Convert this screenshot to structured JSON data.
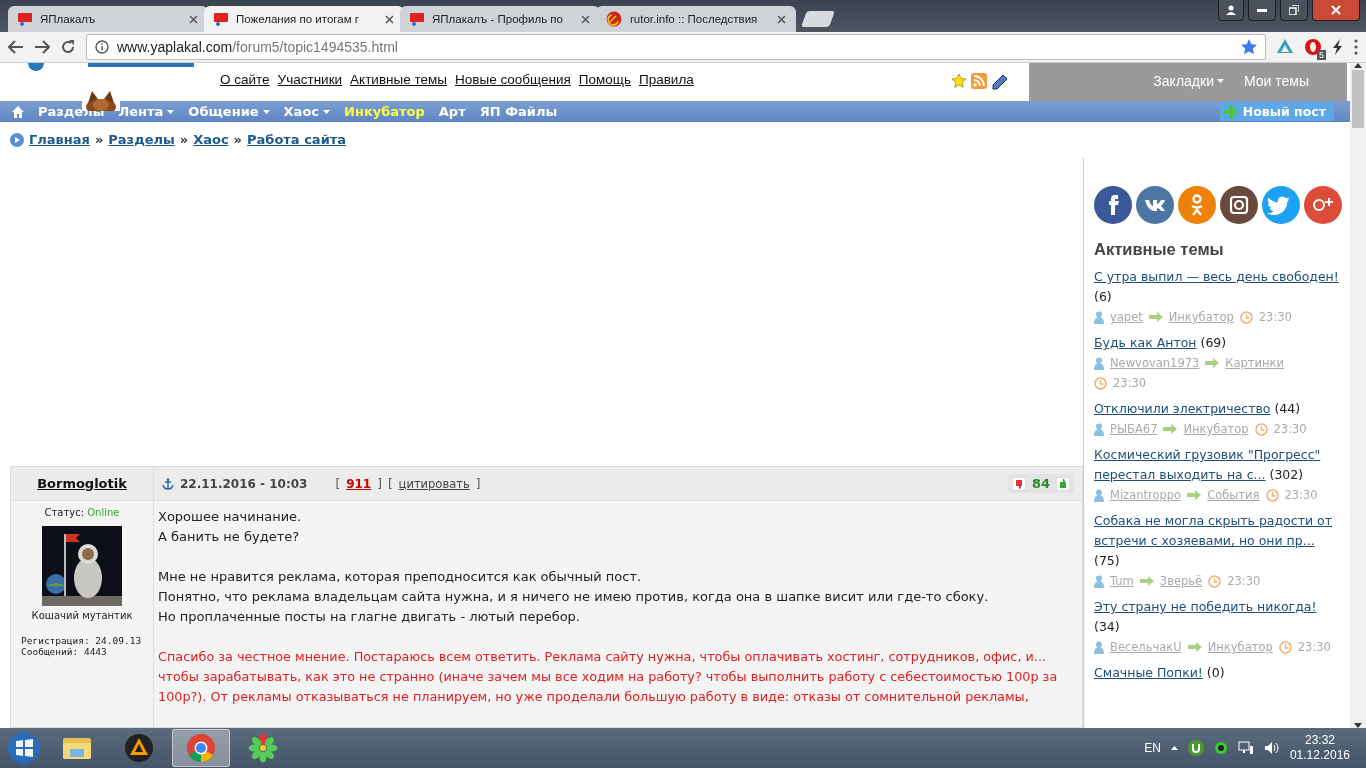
{
  "browser": {
    "tabs": [
      {
        "title": "ЯПлакалъ",
        "selected": false,
        "kind": "yap"
      },
      {
        "title": "Пожелания по итогам г",
        "selected": true,
        "kind": "yap"
      },
      {
        "title": "ЯПлакалъ - Профиль по",
        "selected": false,
        "kind": "yap"
      },
      {
        "title": "rutor.info :: Последствия",
        "selected": false,
        "kind": "rutor"
      }
    ],
    "url_host": "www.yaplakal.com",
    "url_path": "/forum5/topic1494535.html",
    "extension_badge": "5"
  },
  "header": {
    "links": [
      "О сайте",
      "Участники",
      "Активные темы",
      "Новые сообщения",
      "Помощь",
      "Правила"
    ],
    "user_menu": [
      {
        "label": "Закладки",
        "dropdown": true
      },
      {
        "label": "Мои темы",
        "dropdown": false
      }
    ]
  },
  "nav": {
    "items": [
      {
        "label": "Разделы",
        "dropdown": false,
        "highlighted": false
      },
      {
        "label": "Лента",
        "dropdown": true,
        "highlighted": false
      },
      {
        "label": "Общение",
        "dropdown": true,
        "highlighted": false
      },
      {
        "label": "Хаос",
        "dropdown": true,
        "highlighted": false
      },
      {
        "label": "Инкубатор",
        "dropdown": false,
        "highlighted": true
      },
      {
        "label": "Арт",
        "dropdown": false,
        "highlighted": false
      },
      {
        "label": "ЯП Файлы",
        "dropdown": false,
        "highlighted": false
      }
    ],
    "new_post": "Новый пост"
  },
  "breadcrumb": [
    {
      "kind": "link",
      "text": "Главная"
    },
    {
      "kind": "separator",
      "text": "»"
    },
    {
      "kind": "link",
      "text": "Разделы"
    },
    {
      "kind": "separator",
      "text": "»"
    },
    {
      "kind": "link",
      "text": "Хаос"
    },
    {
      "kind": "separator",
      "text": "»"
    },
    {
      "kind": "link",
      "text": "Работа сайта"
    }
  ],
  "post": {
    "author": "Bormoglotik",
    "status_label": "Статус:",
    "status": "Online",
    "rank": "Кошачий мутантик",
    "registration": "Регистрация: 24.09.13",
    "messages": "Сообщений: 4443",
    "date": "22.11.2016 - 10:03",
    "links": [
      {
        "kind": "bracket",
        "text": "["
      },
      {
        "kind": "number",
        "text": "911"
      },
      {
        "kind": "bracket",
        "text": "]"
      },
      {
        "kind": "bracket",
        "text": "["
      },
      {
        "kind": "quote",
        "text": "цитировать"
      },
      {
        "kind": "bracket",
        "text": "]"
      }
    ],
    "rating": "84",
    "paragraphs": [
      {
        "kind": "text",
        "lines": [
          "Хорошее начинание.",
          "А банить не будете?"
        ]
      },
      {
        "kind": "text",
        "lines": [
          "Мне не нравится реклама, которая преподносится как обычный пост.",
          "Понятно, что реклама владельцам сайта нужна, и я ничего не имею против, когда она в шапке висит или где-то сбоку.",
          "Но проплаченные посты на глагне двигать - лютый перебор."
        ]
      },
      {
        "kind": "reply",
        "lines": [
          "Спасибо за честное мнение. Постараюсь всем ответить. Реклама сайту нужна, чтобы оплачивать хостинг, сотрудников, офис, и...",
          "чтобы зарабатывать, как это не странно (иначе зачем мы все ходим на работу? чтобы выполнить работу с себестоимостью 100р за",
          "100р?). От рекламы отказываться не планируем, но уже проделали большую работу в виде: отказы от сомнительной рекламы,"
        ]
      }
    ]
  },
  "sidebar": {
    "title": "Активные темы",
    "topics": [
      {
        "title": "С утра выпил — весь день свободен!",
        "count": "(6)",
        "user": "yapet",
        "section": "Инкубатор",
        "time": "23:30"
      },
      {
        "title": "Будь как Антон",
        "count": "(69)",
        "user": "Newvovan1973",
        "section": "Картинки",
        "time": "23:30"
      },
      {
        "title": "Отключили электричество",
        "count": "(44)",
        "user": "РЫБА67",
        "section": "Инкубатор",
        "time": "23:30"
      },
      {
        "title": "Космический грузовик \"Прогресс\" перестал выходить на с...",
        "count": "(302)",
        "user": "Mizantroppo",
        "section": "События",
        "time": "23:30"
      },
      {
        "title": "Собака не могла скрыть радости от встречи с хозяевами, но они пр...",
        "count": "(75)",
        "user": "Tum",
        "section": "Зверьё",
        "time": "23:30"
      },
      {
        "title": "Эту страну не победить никогда!",
        "count": "(34)",
        "user": "ВесельчакU",
        "section": "Инкубатор",
        "time": "23:30"
      },
      {
        "title": "Смачные Попки!",
        "count": "(0)"
      }
    ]
  },
  "taskbar": {
    "apps": [
      {
        "kind": "explorer",
        "selected": false
      },
      {
        "kind": "aimp",
        "selected": false
      },
      {
        "kind": "chrome",
        "selected": true
      },
      {
        "kind": "icq",
        "selected": false
      }
    ],
    "language": "EN",
    "time": "23:32",
    "date": "01.12.2016"
  }
}
